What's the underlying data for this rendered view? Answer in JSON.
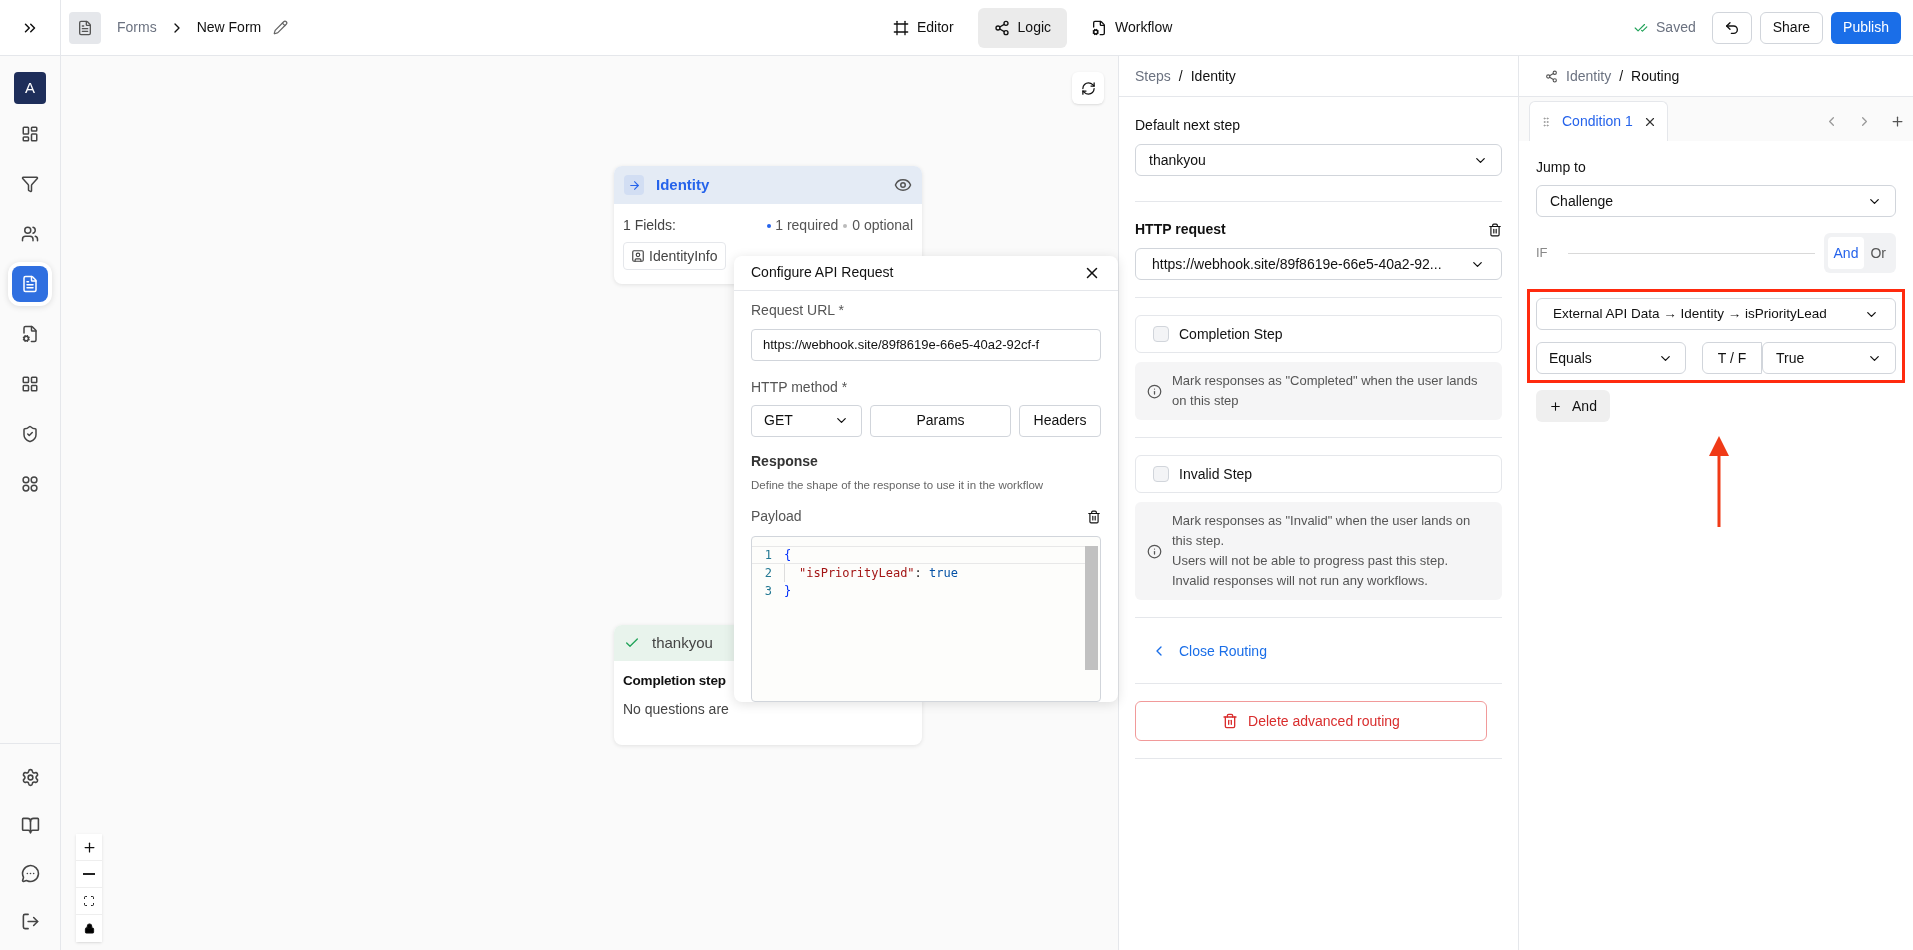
{
  "topbar": {
    "breadcrumb": {
      "parent": "Forms",
      "current": "New Form"
    },
    "tabs": [
      {
        "label": "Editor",
        "kind": "editor",
        "selected": false
      },
      {
        "label": "Logic",
        "kind": "logic",
        "selected": true
      },
      {
        "label": "Workflow",
        "kind": "workflow",
        "selected": false
      }
    ],
    "status": "Saved",
    "share": "Share",
    "publish": "Publish"
  },
  "sidebar": {
    "avatar": "A",
    "items": [
      {
        "kind": "dashboard",
        "selected": false
      },
      {
        "kind": "filter",
        "selected": false
      },
      {
        "kind": "users",
        "selected": false
      },
      {
        "kind": "form",
        "selected": true
      },
      {
        "kind": "form-settings",
        "selected": false
      },
      {
        "kind": "grid",
        "selected": false
      },
      {
        "kind": "shield",
        "selected": false
      },
      {
        "kind": "circles",
        "selected": false
      }
    ],
    "bottom_items": [
      {
        "kind": "settings"
      },
      {
        "kind": "book"
      },
      {
        "kind": "chat"
      },
      {
        "kind": "logout"
      }
    ]
  },
  "canvas": {
    "identity_node": {
      "title": "Identity",
      "fields_label": "1 Fields:",
      "required": "1 required",
      "optional": "0 optional",
      "field_chip": "IdentityInfo"
    },
    "thankyou_node": {
      "title": "thankyou",
      "heading": "Completion step",
      "description": "No questions are"
    },
    "api_dialog": {
      "title": "Configure API Request",
      "url_label": "Request URL *",
      "url": "https://webhook.site/89f8619e-66e5-40a2-92cf-f",
      "method_label": "HTTP method *",
      "method": "GET",
      "params": "Params",
      "headers": "Headers",
      "response_title": "Response",
      "response_hint": "Define the shape of the response to use it in the workflow",
      "payload_label": "Payload",
      "payload_lines": [
        {
          "number": "1",
          "indented": false,
          "tokens": [
            {
              "text": "{",
              "kind": "brace"
            }
          ]
        },
        {
          "number": "2",
          "indented": true,
          "tokens": [
            {
              "text": "\"isPriorityLead\"",
              "kind": "key"
            },
            {
              "text": ": ",
              "kind": "punct"
            },
            {
              "text": "true",
              "kind": "literal"
            }
          ]
        },
        {
          "number": "3",
          "indented": false,
          "tokens": [
            {
              "text": "}",
              "kind": "brace"
            }
          ]
        }
      ]
    }
  },
  "steps_panel": {
    "breadcrumb": {
      "parent": "Steps",
      "separator": "/",
      "current": "Identity"
    },
    "default_next_label": "Default next step",
    "default_next": "thankyou",
    "http_label": "HTTP request",
    "http_value": "https://webhook.site/89f8619e-66e5-40a2-92...",
    "options": [
      {
        "label": "Completion Step",
        "checked": false,
        "info": [
          "Mark responses as \"Completed\" when the user lands on this step"
        ]
      },
      {
        "label": "Invalid Step",
        "checked": false,
        "info": [
          "Mark responses as \"Invalid\" when the user lands on this step.",
          "Users will not be able to progress past this step.",
          "Invalid responses will not run any workflows."
        ]
      }
    ],
    "close_routing": "Close Routing",
    "delete_routing": "Delete advanced routing"
  },
  "routing_panel": {
    "breadcrumb": {
      "parent": "Identity",
      "separator": "/",
      "current": "Routing"
    },
    "conditions": [
      {
        "label": "Condition 1",
        "selected": true
      }
    ],
    "jump_label": "Jump to",
    "jump_value": "Challenge",
    "if_label": "IF",
    "logic": [
      {
        "label": "And",
        "selected": true
      },
      {
        "label": "Or",
        "selected": false
      }
    ],
    "rule": {
      "field": "External API Data → Identity → isPriorityLead",
      "operator": "Equals",
      "type": "T / F",
      "value": "True"
    },
    "add_and": "And"
  }
}
